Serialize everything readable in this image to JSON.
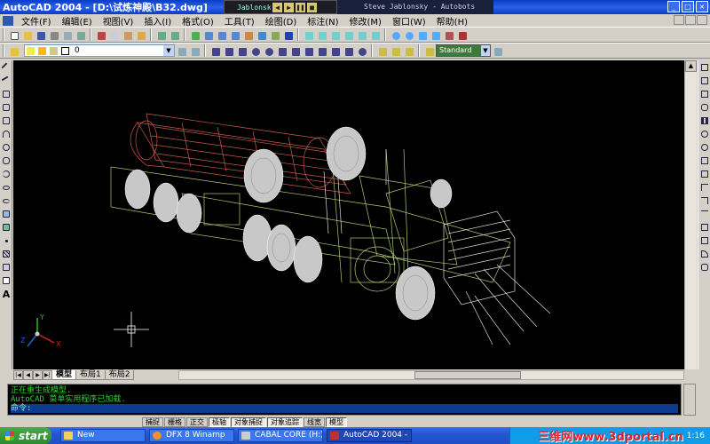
{
  "window": {
    "title": "AutoCAD 2004 - [D:\\试炼神殿\\B32.dwg]",
    "controls": [
      "_",
      "□",
      "×"
    ]
  },
  "winamp": {
    "label": "Jablonsky -",
    "now_playing": "Steve Jablonsky - Autobots",
    "controls": [
      "◀",
      "▶",
      "❚❚",
      "■",
      "▶▶"
    ]
  },
  "menu": {
    "items": [
      "文件(F)",
      "编辑(E)",
      "视图(V)",
      "插入(I)",
      "格式(O)",
      "工具(T)",
      "绘图(D)",
      "标注(N)",
      "修改(M)",
      "窗口(W)",
      "帮助(H)"
    ]
  },
  "layer": {
    "current": "0"
  },
  "textstyle": {
    "current": "Standard"
  },
  "layout_tabs": [
    "模型",
    "布局1",
    "布局2"
  ],
  "command": {
    "lines": [
      "正在重生成模型.",
      "AutoCAD 菜单实用程序已加载."
    ],
    "prompt": "命令:"
  },
  "status": {
    "coords": "",
    "toggles": [
      "捕捉",
      "栅格",
      "正交",
      "极轴",
      "对象捕捉",
      "对象追踪",
      "线宽",
      "模型"
    ],
    "on": [
      "极轴",
      "对象捕捉",
      "对象追踪",
      "模型"
    ]
  },
  "taskbar": {
    "start_label": "start",
    "tasks": [
      {
        "label": "New",
        "icon": "folder-icon"
      },
      {
        "label": "DFX 8 Winamp",
        "icon": "dfx-icon"
      },
      {
        "label": "CABAL CORE (H:)",
        "icon": "drive-icon"
      },
      {
        "label": "AutoCAD 2004 - ...",
        "icon": "autocad-icon"
      }
    ],
    "tray_watermark": "三维网www.3dportal.cn",
    "clock": "1:16"
  },
  "ucs": {
    "x_label": "X",
    "y_label": "Y",
    "z_label": "Z"
  },
  "colors": {
    "truck_body": "#c8c8a0",
    "truck_chassis": "#b0c870",
    "tank": "#c85a4a",
    "wheel": "#c8c8c8",
    "drawing_bg": "#000000",
    "titlebar": "#2a62e8"
  }
}
